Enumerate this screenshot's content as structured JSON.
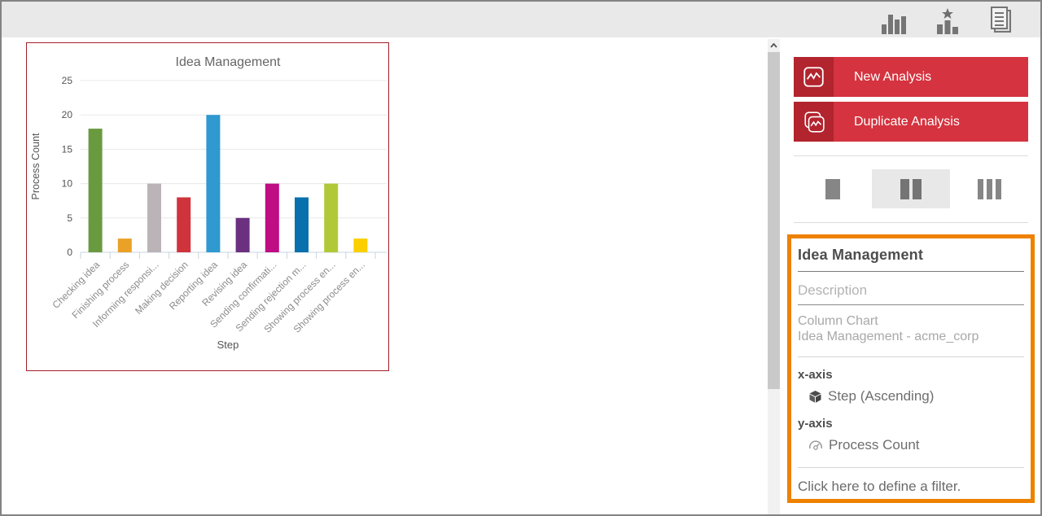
{
  "toolbar": {
    "icons": [
      {
        "name": "column-chart-icon"
      },
      {
        "name": "ranking-icon"
      },
      {
        "name": "report-icon"
      }
    ]
  },
  "right_panel": {
    "new_analysis_label": "New Analysis",
    "duplicate_analysis_label": "Duplicate Analysis",
    "layout_options": [
      "one-column",
      "two-columns",
      "three-columns"
    ],
    "selected_layout": "two-columns",
    "button_color": "#d4333f",
    "button_icon_color": "#b2242e",
    "accent_color": "#ee8100",
    "properties": {
      "title": "Idea Management",
      "description_placeholder": "Description",
      "chart_type": "Column Chart",
      "source": "Idea Management - acme_corp",
      "x_axis_label": "x-axis",
      "x_axis_value": "Step (Ascending)",
      "y_axis_label": "y-axis",
      "y_axis_value": "Process Count",
      "filter_hint": "Click here to define a filter."
    }
  },
  "chart_data": {
    "type": "bar",
    "title": "Idea Management",
    "xlabel": "Step",
    "ylabel": "Process Count",
    "categories": [
      "Checking idea",
      "Finishing process",
      "Informing responsi...",
      "Making decision",
      "Reporting idea",
      "Revising idea",
      "Sending confirmati...",
      "Sending rejection m...",
      "Showing process en...",
      "Showing process en..."
    ],
    "values": [
      18,
      2,
      10,
      8,
      20,
      5,
      10,
      8,
      10,
      2
    ],
    "colors": [
      "#6a9a3f",
      "#e9a227",
      "#bab3b8",
      "#cf333c",
      "#2f99d0",
      "#6b3180",
      "#bf0d83",
      "#0871ad",
      "#b2c937",
      "#fccf00"
    ],
    "yticks": [
      0,
      5,
      10,
      15,
      20,
      25
    ],
    "ylim": [
      0,
      25
    ],
    "grid": true,
    "legend": false,
    "tile_border_color": "#a21f27"
  }
}
